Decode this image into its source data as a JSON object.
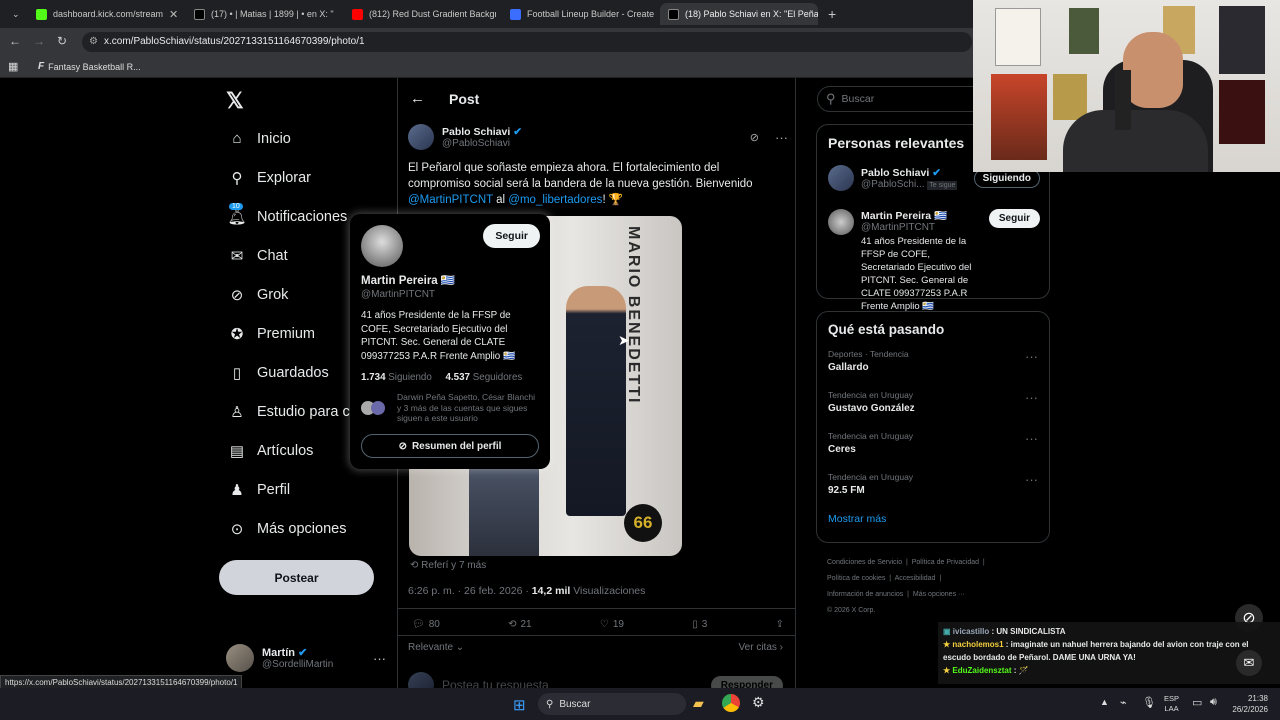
{
  "browser": {
    "tabs": [
      {
        "label": "dashboard.kick.com/stream",
        "color": "#53fc18"
      },
      {
        "label": "(17) • | Matias | 1899 | • en X: \"",
        "color": "#000000"
      },
      {
        "label": "(812) Red Dust Gradient Backgr",
        "color": "#ff0000"
      },
      {
        "label": "Football Lineup Builder - Create",
        "color": "#3b6dff"
      },
      {
        "label": "(18) Pablo Schiavi en X: \"El Peña",
        "color": "#000000"
      }
    ],
    "new_tab": "+",
    "url": "x.com/PabloSchiavi/status/2027133151164670399/photo/1",
    "bookmark": "Fantasy Basketball R...",
    "status_url": "https://x.com/PabloSchiavi/status/2027133151164670399/photo/1"
  },
  "nav": {
    "items": [
      {
        "label": "Inicio",
        "icon": "home-icon"
      },
      {
        "label": "Explorar",
        "icon": "search-icon"
      },
      {
        "label": "Notificaciones",
        "icon": "bell-icon"
      },
      {
        "label": "Chat",
        "icon": "mail-icon"
      },
      {
        "label": "Grok",
        "icon": "grok-icon"
      },
      {
        "label": "Premium",
        "icon": "verified-icon"
      },
      {
        "label": "Guardados",
        "icon": "bookmark-icon"
      },
      {
        "label": "Estudio para cr",
        "icon": "studio-icon"
      },
      {
        "label": "Artículos",
        "icon": "article-icon"
      },
      {
        "label": "Perfil",
        "icon": "person-icon"
      },
      {
        "label": "Más opciones",
        "icon": "more-circle-icon"
      }
    ],
    "notif_badge": "10",
    "post_button": "Postear",
    "account_name": "Martín",
    "account_handle": "@SordelliMartin"
  },
  "post": {
    "header": "Post",
    "author_name": "Pablo Schiavi",
    "author_handle": "@PabloSchiavi",
    "text1": "El Peñarol que soñaste empieza ahora. El fortalecimiento del compromiso social será la bandera de la nueva gestión. Bienvenido",
    "mention1": "@MartinPITCNT",
    "text_al": " al ",
    "mention2": "@mo_libertadores",
    "text_end": "! 🏆",
    "image_text": "MARIO BENEDETTI",
    "image_badge": "66",
    "repost_info": "Referí y 7 más",
    "time": "6:26 p. m. · 26 feb. 2026 · ",
    "views": "14,2 mil",
    "views_label": " Visualizaciones",
    "replies": "80",
    "reposts": "21",
    "likes": "19",
    "bookmarks": "3",
    "relevance": "Relevante",
    "see_quotes": "Ver citas",
    "reply_placeholder": "Postea tu respuesta",
    "reply_button": "Responder"
  },
  "hovercard": {
    "follow": "Seguir",
    "name": "Martin Pereira 🇺🇾",
    "handle": "@MartinPITCNT",
    "bio": "41 años Presidente de la FFSP de COFE, Secretariado Ejecutivo del PITCNT. Sec. General de CLATE 099377253 P.A.R Frente Amplio 🇺🇾",
    "following": "1.734",
    "following_label": " Siguiendo",
    "followers": "4.537",
    "followers_label": " Seguidores",
    "followed_by": "Darwin Peña Sapetto, César Blanchi y 3 más de las cuentas que sigues siguen a este usuario",
    "summary": "Resumen del perfil"
  },
  "right": {
    "search_placeholder": "Buscar",
    "relevant_title": "Personas relevantes",
    "person1_name": "Pablo Schiavi",
    "person1_handle": "@PabloSchi...",
    "person1_tag": "Te sigue",
    "person1_button": "Siguiendo",
    "person2_name": "Martin Pereira 🇺🇾",
    "person2_handle": "@MartinPITCNT",
    "person2_bio": "41 años Presidente de la FFSP de COFE, Secretariado Ejecutivo del PITCNT. Sec. General de CLATE 099377253 P.A.R Frente Amplio 🇺🇾",
    "person2_button": "Seguir",
    "trending_title": "Qué está pasando",
    "trends": [
      {
        "context": "Deportes · Tendencia",
        "name": "Gallardo"
      },
      {
        "context": "Tendencia en Uruguay",
        "name": "Gustavo González"
      },
      {
        "context": "Tendencia en Uruguay",
        "name": "Ceres"
      },
      {
        "context": "Tendencia en Uruguay",
        "name": "92.5 FM"
      }
    ],
    "show_more": "Mostrar más",
    "footer": [
      "Condiciones de Servicio",
      "Política de Privacidad",
      "Política de cookies",
      "Accesibilidad",
      "Información de anuncios",
      "Más opciones ···",
      "© 2026 X Corp."
    ]
  },
  "chat": [
    {
      "user": "ivicastillo",
      "text": " : UN SINDICALISTA",
      "color": "#9aa7b8"
    },
    {
      "user": "nacholemos1",
      "text": " : imaginate un nahuel herrera bajando del avion con traje con el escudo bordado de Peñarol. DAME UNA URNA YA!",
      "color": "#f4d03f"
    },
    {
      "user": "EduZaidensztat",
      "text": " : 🪄",
      "color": "#53fc18"
    }
  ],
  "taskbar": {
    "search": "Buscar",
    "lang1": "ESP",
    "lang2": "LAA",
    "time": "21:38",
    "date": "26/2/2026"
  }
}
